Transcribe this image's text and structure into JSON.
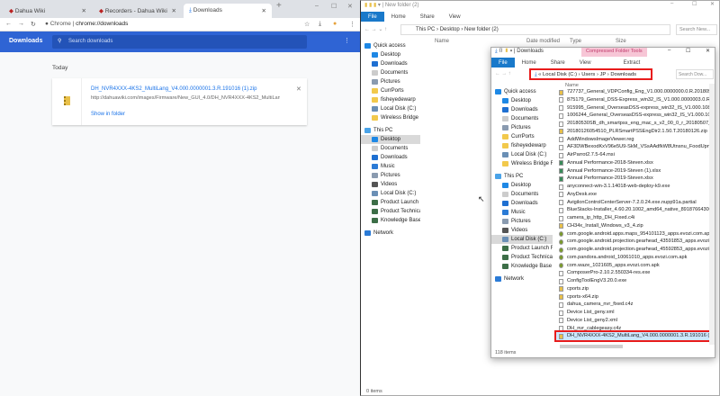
{
  "chrome": {
    "tabs": [
      {
        "label": "Dahua Wiki",
        "icon": "dahua-favicon"
      },
      {
        "label": "Recorders - Dahua Wiki",
        "icon": "dahua-favicon"
      },
      {
        "label": "Downloads",
        "icon": "download-icon"
      }
    ],
    "omnibox": {
      "site": "Chrome",
      "url": "chrome://downloads"
    },
    "page_title": "Downloads",
    "search_placeholder": "Search downloads",
    "section": "Today",
    "download": {
      "filename": "DH_NVR4XXX-4KS2_MultiLang_V4.000.0000001.3.R.191016 (1).zip",
      "url": "http://dahuawiki.com/images/Firmware/New_GUI_4.0/DH_NVR4XXX-4KS2_MultiLan...",
      "action": "Show in folder"
    },
    "accent": "#2f64d4"
  },
  "explorer1": {
    "title": "New folder (2)",
    "ribbon": [
      "File",
      "Home",
      "Share",
      "View"
    ],
    "breadcrumb": [
      "This PC",
      "Desktop",
      "New folder (2)"
    ],
    "search_placeholder": "Search New...",
    "columns": [
      "Name",
      "Date modified",
      "Type",
      "Size"
    ],
    "status": "0 items"
  },
  "explorer2": {
    "title": "Downloads",
    "context_tab": "Compressed Folder Tools",
    "ribbon": [
      "File",
      "Home",
      "Share",
      "View",
      "Extract"
    ],
    "breadcrumb": [
      "Local Disk (C:)",
      "Users",
      "JP",
      "Downloads"
    ],
    "search_placeholder": "Search Dow...",
    "column": "Name",
    "status": "118 items",
    "files": [
      "727737_General_VDPConfig_Eng_V1.000.0000000.0.R.20180918.zip",
      "875179_General_DSS-Express_win32_IS_V1.000.0000003.0.R.20180610.exe",
      "915995_General_OverseasDSS-express_win32_IS_V1.000.1080000.0.R.201...",
      "1006244_General_OverseasDSS-express_win32_IS_V1.000.1080004.1.R.20...",
      "20180530SB_dh_smartpss_eng_mac_s_v2_00_0_r_20180507_codesign1.z...",
      "20180126054510_PLRSmartPSSEngDir2.1.50.T.20180126.zip",
      "AddWindowsImageViewer.reg",
      "AF3DWBexodKxV96e5U9-SkM_VSsAAdfkW8Utnsnu_FoodUpngRfhEx...",
      "AirParrot2.7.5-64.msi",
      "Annual Performance-2018-Steven.xlsx",
      "Annual Performance-2019-Steven (1).xlsx",
      "Annual Performance-2019-Steven.xlsx",
      "anyconnect-win-3.1.14018-web-deploy-k9.exe",
      "AnyDesk.exe",
      "AvigilonControlCenterServer-7.2.0.24.exe.nupp91a.partial",
      "BlueStacks-Installer_4.60.20.1002_amd64_native_89187664300a2081417...",
      "camera_ip_http_DH_Fixed.c4i",
      "CH34x_Install_Windows_v3_4.zip",
      "com.google.android.apps.maps_954101123_apps.evozi.com.apk",
      "com.google.android.projection.gearhead_43591853_apps.evozi.com.apk",
      "com.google.android.projection.gearhead_45592853_apps.evozi.com.apk",
      "com.pandora.android_10061010_apps.evozi.com.apk",
      "com.waze_1021605_apps.evozi.com.apk",
      "ComposerPro-2.10.2.550334-res.exe",
      "ConfigToolEngV3.20.0.exe",
      "cports.zip",
      "cports-x64.zip",
      "dahua_camera_nvr_fixed.c4z",
      "Device List_geny.xml",
      "Device List_geny2.xml",
      "DH_nvr_cablegeasy.c4z",
      "DH_NVR4XXX-4KS2_MultiLang_V4.000.0000001.3.R.191016 (1).zip"
    ],
    "selected_index": 31
  },
  "nav": [
    {
      "label": "Quick access",
      "hdr": true,
      "color": "#1e88e5"
    },
    {
      "label": "Desktop",
      "color": "#1e88e5"
    },
    {
      "label": "Downloads",
      "color": "#1e6fd1"
    },
    {
      "label": "Documents",
      "color": "#ccc"
    },
    {
      "label": "Pictures",
      "color": "#8a9bb0"
    },
    {
      "label": "CurrPorts",
      "color": "#f2c94c"
    },
    {
      "label": "fisheyedewarp",
      "color": "#f2c94c"
    },
    {
      "label": "Local Disk (C:)",
      "color": "#6a8fb5"
    },
    {
      "label": "Wireless Bridge Resou",
      "color": "#f2c94c"
    },
    {
      "label": "This PC",
      "hdr": true,
      "color": "#4aa3e8"
    },
    {
      "label": "Desktop",
      "color": "#1e88e5"
    },
    {
      "label": "Documents",
      "color": "#ccc"
    },
    {
      "label": "Downloads",
      "color": "#1e6fd1"
    },
    {
      "label": "Music",
      "color": "#2b7bd6"
    },
    {
      "label": "Pictures",
      "color": "#8a9bb0"
    },
    {
      "label": "Videos",
      "color": "#555"
    },
    {
      "label": "Local Disk (C:)",
      "color": "#6a8fb5"
    },
    {
      "label": "Product Launch Files",
      "color": "#3c6e47"
    },
    {
      "label": "Product Technical S",
      "color": "#3c6e47"
    },
    {
      "label": "Knowledge Base (\\\\",
      "color": "#3c6e47"
    },
    {
      "label": "Network",
      "hdr": true,
      "color": "#2b7bd6"
    }
  ]
}
